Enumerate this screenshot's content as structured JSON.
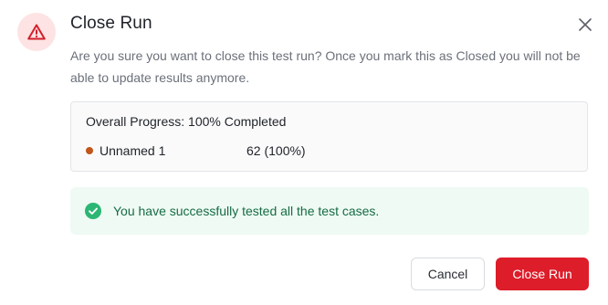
{
  "dialog": {
    "title": "Close Run",
    "description": "Are you sure you want to close this test run? Once you mark this as Closed you will not be able to update results anymore.",
    "icons": {
      "header": "warning-triangle-icon",
      "close": "close-x-icon",
      "success": "check-circle-icon"
    },
    "colors": {
      "danger": "#dd1d2a",
      "success_text": "#176b45",
      "success_bg": "#eefaf3",
      "status_dot": "#c0561a"
    }
  },
  "progress": {
    "heading": "Overall Progress: 100% Completed",
    "rows": [
      {
        "name": "Unnamed 1",
        "value": "62 (100%)"
      }
    ]
  },
  "success_message": "You have successfully tested all the test cases.",
  "buttons": {
    "cancel": "Cancel",
    "confirm": "Close Run"
  }
}
